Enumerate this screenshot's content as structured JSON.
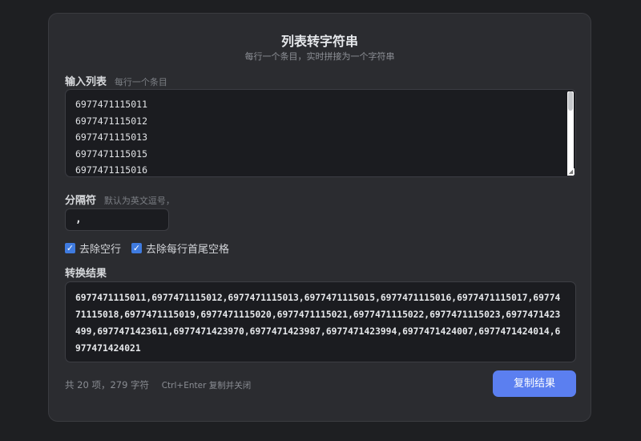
{
  "header": {
    "title": "列表转字符串",
    "subtitle": "每行一个条目，实时拼接为一个字符串"
  },
  "input_section": {
    "label": "输入列表",
    "hint": "每行一个条目",
    "visible_lines": [
      "6977471115011",
      "6977471115012",
      "6977471115013",
      "6977471115015",
      "6977471115016"
    ]
  },
  "separator_section": {
    "label": "分隔符",
    "hint": "默认为英文逗号，",
    "value": ","
  },
  "options": {
    "remove_empty_label": "去除空行",
    "remove_empty_checked": true,
    "trim_label": "去除每行首尾空格",
    "trim_checked": true
  },
  "result_section": {
    "label": "转换结果",
    "value": "6977471115011,6977471115012,6977471115013,6977471115015,6977471115016,6977471115017,6977471115018,6977471115019,6977471115020,6977471115021,6977471115022,6977471115023,6977471423499,6977471423611,6977471423970,6977471423987,6977471423994,6977471424007,6977471424014,6977471424021"
  },
  "footer": {
    "stats": "共 20 项，279 字符",
    "shortcut": "Ctrl+Enter 复制并关闭",
    "copy_label": "复制结果"
  },
  "colors": {
    "background": "#1e1f22",
    "panel": "#2b2c30",
    "accent": "#5b7ff0",
    "checkbox": "#3f7be0"
  }
}
